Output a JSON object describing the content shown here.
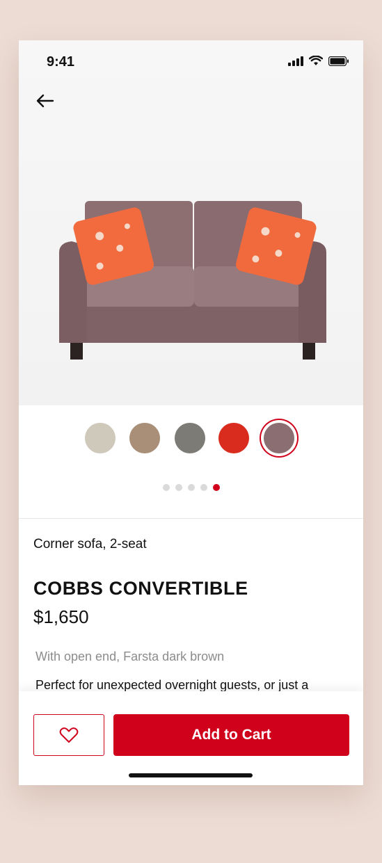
{
  "status_bar": {
    "time": "9:41"
  },
  "product": {
    "category": "Corner sofa, 2-seat",
    "name": "COBBS CONVERTIBLE",
    "price": "$1,650",
    "variant": "With open end, Farsta dark brown",
    "description": "Perfect for unexpected overnight guests, or just a"
  },
  "swatches": [
    {
      "color": "#cfc9bc",
      "selected": false
    },
    {
      "color": "#a98f78",
      "selected": false
    },
    {
      "color": "#7d7b75",
      "selected": false
    },
    {
      "color": "#d92c1e",
      "selected": false
    },
    {
      "color": "#8a6e72",
      "selected": true
    }
  ],
  "carousel": {
    "pages": 5,
    "active_page": 5
  },
  "actions": {
    "wishlist_icon": "heart-icon",
    "add_to_cart_label": "Add to Cart"
  },
  "theme": {
    "accent": "#d0021b",
    "background": "#ecdcd4"
  }
}
